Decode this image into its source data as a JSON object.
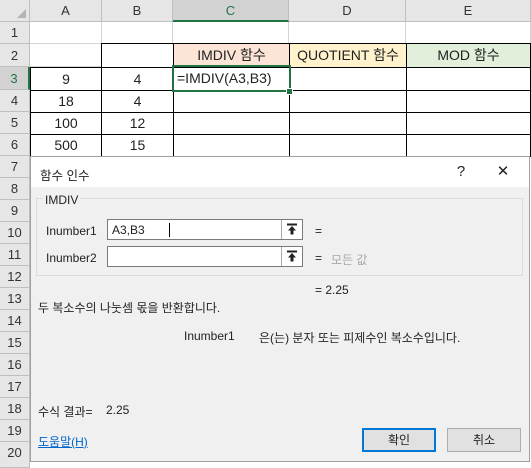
{
  "columns": [
    "A",
    "B",
    "C",
    "D",
    "E"
  ],
  "rows": [
    "1",
    "2",
    "3",
    "4",
    "5",
    "6",
    "7",
    "8",
    "9",
    "10",
    "11",
    "12",
    "13",
    "14",
    "15",
    "16",
    "17",
    "18",
    "19",
    "20"
  ],
  "headers_row2": {
    "C": {
      "text": "IMDIV 함수",
      "bg": "#fce4d6"
    },
    "D": {
      "text": "QUOTIENT 함수",
      "bg": "#fff2cc"
    },
    "E": {
      "text": "MOD 함수",
      "bg": "#e2efda"
    }
  },
  "data_rows": [
    {
      "row": "3",
      "A": "9",
      "B": "4",
      "C": "=IMDIV(A3,B3)"
    },
    {
      "row": "4",
      "A": "18",
      "B": "4"
    },
    {
      "row": "5",
      "A": "100",
      "B": "12"
    },
    {
      "row": "6",
      "A": "500",
      "B": "15"
    }
  ],
  "active_cell": "C3",
  "dialog": {
    "title": "함수 인수",
    "help_glyph": "?",
    "close_glyph": "✕",
    "function_name": "IMDIV",
    "args": [
      {
        "name": "Inumber1",
        "value": "A3,B3",
        "result": "="
      },
      {
        "name": "Inumber2",
        "value": "",
        "result": "=",
        "hint": "모든 값"
      }
    ],
    "func_result": "=  2.25",
    "description": "두 복소수의 나눗셈 몫을 반환합니다.",
    "arg_help_name": "Inumber1",
    "arg_help_text": "은(는) 분자 또는 피제수인 복소수입니다.",
    "formula_result_label": "수식 결과=",
    "formula_result_value": "2.25",
    "help_link": "도움말(H)",
    "ok_label": "확인",
    "cancel_label": "취소"
  },
  "colors": {
    "excel_green": "#217346",
    "link_blue": "#0066cc",
    "primary_border": "#0078d7"
  },
  "icons": [
    "select-all-triangle-icon",
    "collapse-dialog-icon"
  ]
}
